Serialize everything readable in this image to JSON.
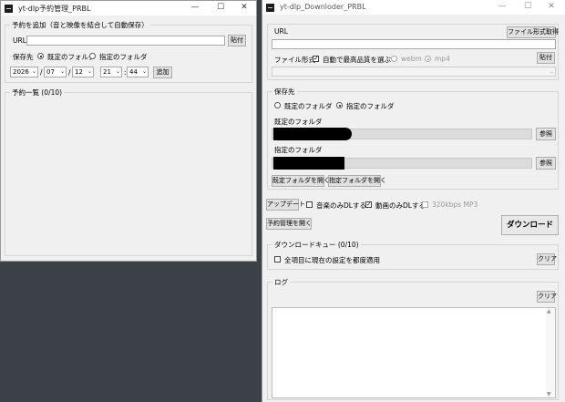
{
  "scheduler": {
    "title": "yt-dlp予約管理_PRBL",
    "add_group": "予約を追加（音と映像を結合して自動保存）",
    "url_label": "URL",
    "paste_btn": "貼付",
    "save_label": "保存先",
    "radio_default": "既定のフォルダ",
    "radio_specified": "指定のフォルダ",
    "year": "2026",
    "month": "07",
    "day": "12",
    "hour": "21",
    "minute": "44",
    "sep_slash": "/",
    "sep_colon": ":",
    "add_btn": "追加",
    "list_group": "予約一覧 (0/10)"
  },
  "downloader": {
    "title": "yt-dlp_Downloder_PRBL",
    "url_label": "URL",
    "fetch_format_btn": "ファイル形式取得",
    "format_label": "ファイル形式",
    "auto_best_label": "自動で最高品質を選ぶ",
    "webm_label": "webm",
    "mp4_label": "mp4",
    "paste_btn": "貼付",
    "save_group": "保存先",
    "radio_default": "既定のフォルダ",
    "radio_specified": "指定のフォルダ",
    "default_folder_label": "既定のフォルダ",
    "browse_btn": "参照",
    "specified_folder_label": "指定のフォルダ",
    "open_default_btn": "既定フォルダを開く",
    "open_specified_btn": "指定フォルダを開く",
    "update_btn": "アップデート",
    "audio_only_label": "音楽のみDLする",
    "video_only_label": "動画のみDLする",
    "mp3_label": "320kbps MP3",
    "schedule_btn": "予約管理を開く",
    "download_btn": "ダウンロード",
    "queue_group": "ダウンロードキュー (0/10)",
    "apply_all_label": "全項目に現在の設定を都度適用",
    "clear_btn": "クリア",
    "log_group": "ログ"
  },
  "window_controls": {
    "minimize": "—",
    "maximize": "☐",
    "close": "✕"
  }
}
